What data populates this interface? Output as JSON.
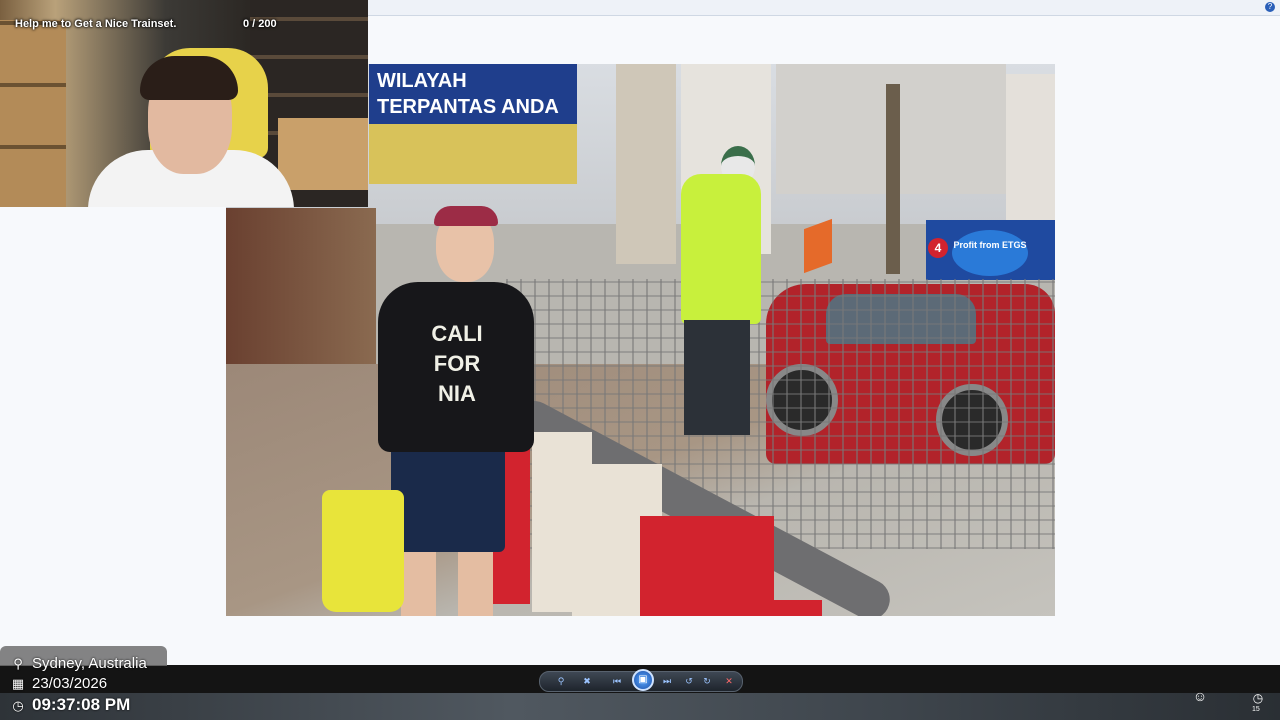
{
  "stream": {
    "title": "Help me to Get a Nice Trainset.",
    "counter": "0 / 200"
  },
  "photo": {
    "billboard_line1": "WILAYAH",
    "billboard_line2": "TERPANTAS ANDA",
    "shirt_print_1": "CALI",
    "shirt_print_2": "FOR",
    "shirt_print_3": "NIA",
    "sign_text": "Profit from ETGS",
    "sign_number": "4"
  },
  "overlay": {
    "location": "Sydney, Australia",
    "date": "23/03/2026",
    "time": "09:37:08 PM"
  },
  "toolbar": {
    "icons": [
      "zoom-icon",
      "fit-icon",
      "prev-icon",
      "slideshow-icon",
      "next-icon",
      "rotate-left-icon",
      "rotate-right-icon",
      "delete-icon"
    ]
  },
  "system": {
    "clock_small": "15"
  }
}
